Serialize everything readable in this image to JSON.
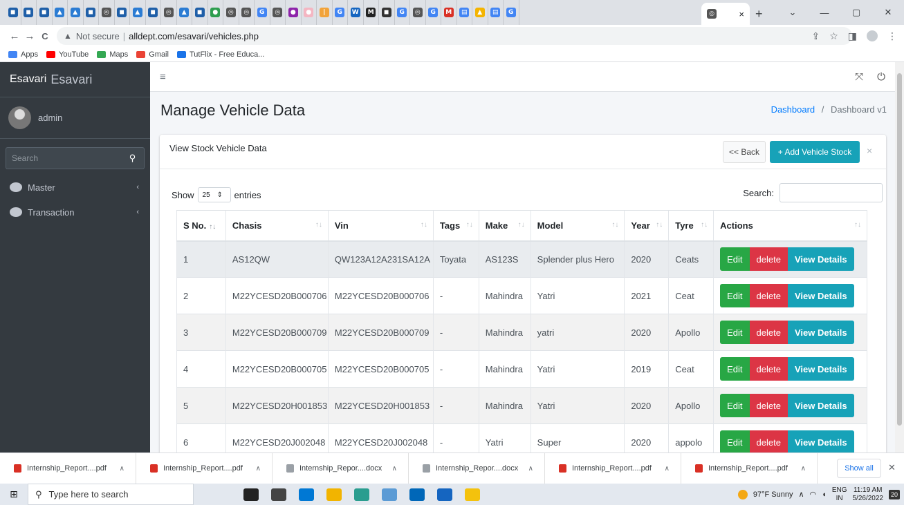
{
  "browser": {
    "favicons": [
      {
        "name": "tab-favicon-1",
        "color": "#1f5fa8",
        "glyph": "◼"
      },
      {
        "name": "tab-favicon-2",
        "color": "#1f5fa8",
        "glyph": "◼"
      },
      {
        "name": "tab-favicon-3",
        "color": "#1f5fa8",
        "glyph": "◼"
      },
      {
        "name": "tab-favicon-4",
        "color": "#2b7cd3",
        "glyph": "▲"
      },
      {
        "name": "tab-favicon-5",
        "color": "#2b7cd3",
        "glyph": "▲"
      },
      {
        "name": "tab-favicon-6",
        "color": "#1f5fa8",
        "glyph": "◼"
      },
      {
        "name": "tab-favicon-7",
        "color": "#555555",
        "glyph": "◎"
      },
      {
        "name": "tab-favicon-8",
        "color": "#1f5fa8",
        "glyph": "◼"
      },
      {
        "name": "tab-favicon-9",
        "color": "#2b7cd3",
        "glyph": "▲"
      },
      {
        "name": "tab-favicon-10",
        "color": "#1f5fa8",
        "glyph": "◼"
      },
      {
        "name": "tab-favicon-11",
        "color": "#555555",
        "glyph": "◎"
      },
      {
        "name": "tab-favicon-12",
        "color": "#2b7cd3",
        "glyph": "▲"
      },
      {
        "name": "tab-favicon-13",
        "color": "#1f5fa8",
        "glyph": "◼"
      },
      {
        "name": "tab-favicon-14",
        "color": "#2e9e4f",
        "glyph": "●"
      },
      {
        "name": "tab-favicon-15",
        "color": "#555555",
        "glyph": "◎"
      },
      {
        "name": "tab-favicon-16",
        "color": "#555555",
        "glyph": "◎"
      },
      {
        "name": "tab-favicon-17",
        "color": "#4285f4",
        "glyph": "G"
      },
      {
        "name": "tab-favicon-18",
        "color": "#555555",
        "glyph": "◎"
      },
      {
        "name": "tab-favicon-19",
        "color": "#8e24aa",
        "glyph": "●"
      },
      {
        "name": "tab-favicon-20",
        "color": "#f4b6c2",
        "glyph": "●"
      },
      {
        "name": "tab-favicon-21",
        "color": "#f2a33a",
        "glyph": "|"
      },
      {
        "name": "tab-favicon-22",
        "color": "#4285f4",
        "glyph": "G"
      },
      {
        "name": "tab-favicon-23",
        "color": "#1565c0",
        "glyph": "W"
      },
      {
        "name": "tab-favicon-24",
        "color": "#222222",
        "glyph": "M"
      },
      {
        "name": "tab-favicon-25",
        "color": "#333333",
        "glyph": "◼"
      },
      {
        "name": "tab-favicon-26",
        "color": "#4285f4",
        "glyph": "G"
      },
      {
        "name": "tab-favicon-27",
        "color": "#555555",
        "glyph": "◎"
      },
      {
        "name": "tab-favicon-28",
        "color": "#4285f4",
        "glyph": "G"
      },
      {
        "name": "tab-favicon-29",
        "color": "#d93025",
        "glyph": "M"
      },
      {
        "name": "tab-favicon-30",
        "color": "#4285f4",
        "glyph": "▤"
      },
      {
        "name": "tab-favicon-31",
        "color": "#f4b400",
        "glyph": "▲"
      },
      {
        "name": "tab-favicon-32",
        "color": "#4285f4",
        "glyph": "▤"
      },
      {
        "name": "tab-favicon-33",
        "color": "#4285f4",
        "glyph": "G"
      }
    ],
    "active_tab_close": "×",
    "new_tab": "+",
    "window_controls": [
      "⌄",
      "—",
      "▢",
      "✕"
    ],
    "nav": {
      "back": "←",
      "forward": "→",
      "reload": "C"
    },
    "security_label": "Not secure",
    "url": "alldept.com/esavari/vehicles.php",
    "bookmarks": [
      {
        "label": "Apps",
        "color": "#4285f4"
      },
      {
        "label": "YouTube",
        "color": "#ff0000"
      },
      {
        "label": "Maps",
        "color": "#34a853"
      },
      {
        "label": "Gmail",
        "color": "#ea4335"
      },
      {
        "label": "TutFlix - Free Educa...",
        "color": "#1a73e8"
      }
    ]
  },
  "sidebar": {
    "brand_img_alt": "Esavari",
    "brand_text": "Esavari",
    "user_name": "admin",
    "search_placeholder": "Search",
    "items": [
      {
        "label": "Master"
      },
      {
        "label": "Transaction"
      }
    ]
  },
  "topnav": {
    "menu_icon": "≡",
    "expand_icon": "⤧",
    "power_icon": "⏻"
  },
  "page": {
    "title": "Manage Vehicle Data",
    "breadcrumb_link": "Dashboard",
    "breadcrumb_sep": "/",
    "breadcrumb_current": "Dashboard v1"
  },
  "card": {
    "title": "View Stock Vehicle Data",
    "back_label": "<< Back",
    "add_label": "+ Add Vehicle Stock",
    "close": "×"
  },
  "datatable": {
    "show_label": "Show",
    "entries_value": "25",
    "entries_label": "entries",
    "search_label": "Search:",
    "columns": [
      "S No.",
      "Chasis",
      "Vin",
      "Tags",
      "Make",
      "Model",
      "Year",
      "Tyre",
      "Actions"
    ],
    "rows": [
      {
        "sno": "1",
        "chasis": "AS12QW",
        "vin": "QW123A12A231SA12A",
        "tags": "Toyata",
        "make": "AS123S",
        "model": "Splender plus Hero",
        "year": "2020",
        "tyre": "Ceats"
      },
      {
        "sno": "2",
        "chasis": "M22YCESD20B000706",
        "vin": "M22YCESD20B000706",
        "tags": "-",
        "make": "Mahindra",
        "model": "Yatri",
        "year": "2021",
        "tyre": "Ceat"
      },
      {
        "sno": "3",
        "chasis": "M22YCESD20B000709",
        "vin": "M22YCESD20B000709",
        "tags": "-",
        "make": "Mahindra",
        "model": "yatri",
        "year": "2020",
        "tyre": "Apollo"
      },
      {
        "sno": "4",
        "chasis": "M22YCESD20B000705",
        "vin": "M22YCESD20B000705",
        "tags": "-",
        "make": "Mahindra",
        "model": "Yatri",
        "year": "2019",
        "tyre": "Ceat"
      },
      {
        "sno": "5",
        "chasis": "M22YCESD20H001853",
        "vin": "M22YCESD20H001853",
        "tags": "-",
        "make": "Mahindra",
        "model": "Yatri",
        "year": "2020",
        "tyre": "Apollo"
      },
      {
        "sno": "6",
        "chasis": "M22YCESD20J002048",
        "vin": "M22YCESD20J002048",
        "tags": "-",
        "make": "Yatri",
        "model": "Super",
        "year": "2020",
        "tyre": "appolo"
      }
    ],
    "actions": {
      "edit": "Edit",
      "delete": "delete",
      "view": "View Details"
    }
  },
  "downloads": {
    "items": [
      {
        "label": "Internship_Report....pdf",
        "color": "#d93025"
      },
      {
        "label": "Internship_Report....pdf",
        "color": "#d93025"
      },
      {
        "label": "Internship_Repor....docx",
        "color": "#9aa0a6"
      },
      {
        "label": "Internship_Repor....docx",
        "color": "#9aa0a6"
      },
      {
        "label": "Internship_Report....pdf",
        "color": "#d93025"
      },
      {
        "label": "Internship_Report....pdf",
        "color": "#d93025"
      }
    ],
    "show_all": "Show all",
    "close": "✕"
  },
  "taskbar": {
    "search_placeholder": "Type here to search",
    "apps": [
      "#222222",
      "#444444",
      "#0078d4",
      "#f2b400",
      "#2a9d8f",
      "#5b9bd5",
      "#0067b8",
      "#1565c0",
      "#f4c20d"
    ],
    "weather": "97°F  Sunny",
    "lang_1": "ENG",
    "lang_2": "IN",
    "time": "11:19 AM",
    "date": "5/26/2022",
    "notif_count": "20"
  },
  "colors": {
    "sidebar_bg": "#343a40",
    "info": "#17a2b8",
    "success": "#28a745",
    "danger": "#dc3545",
    "link": "#007bff"
  }
}
